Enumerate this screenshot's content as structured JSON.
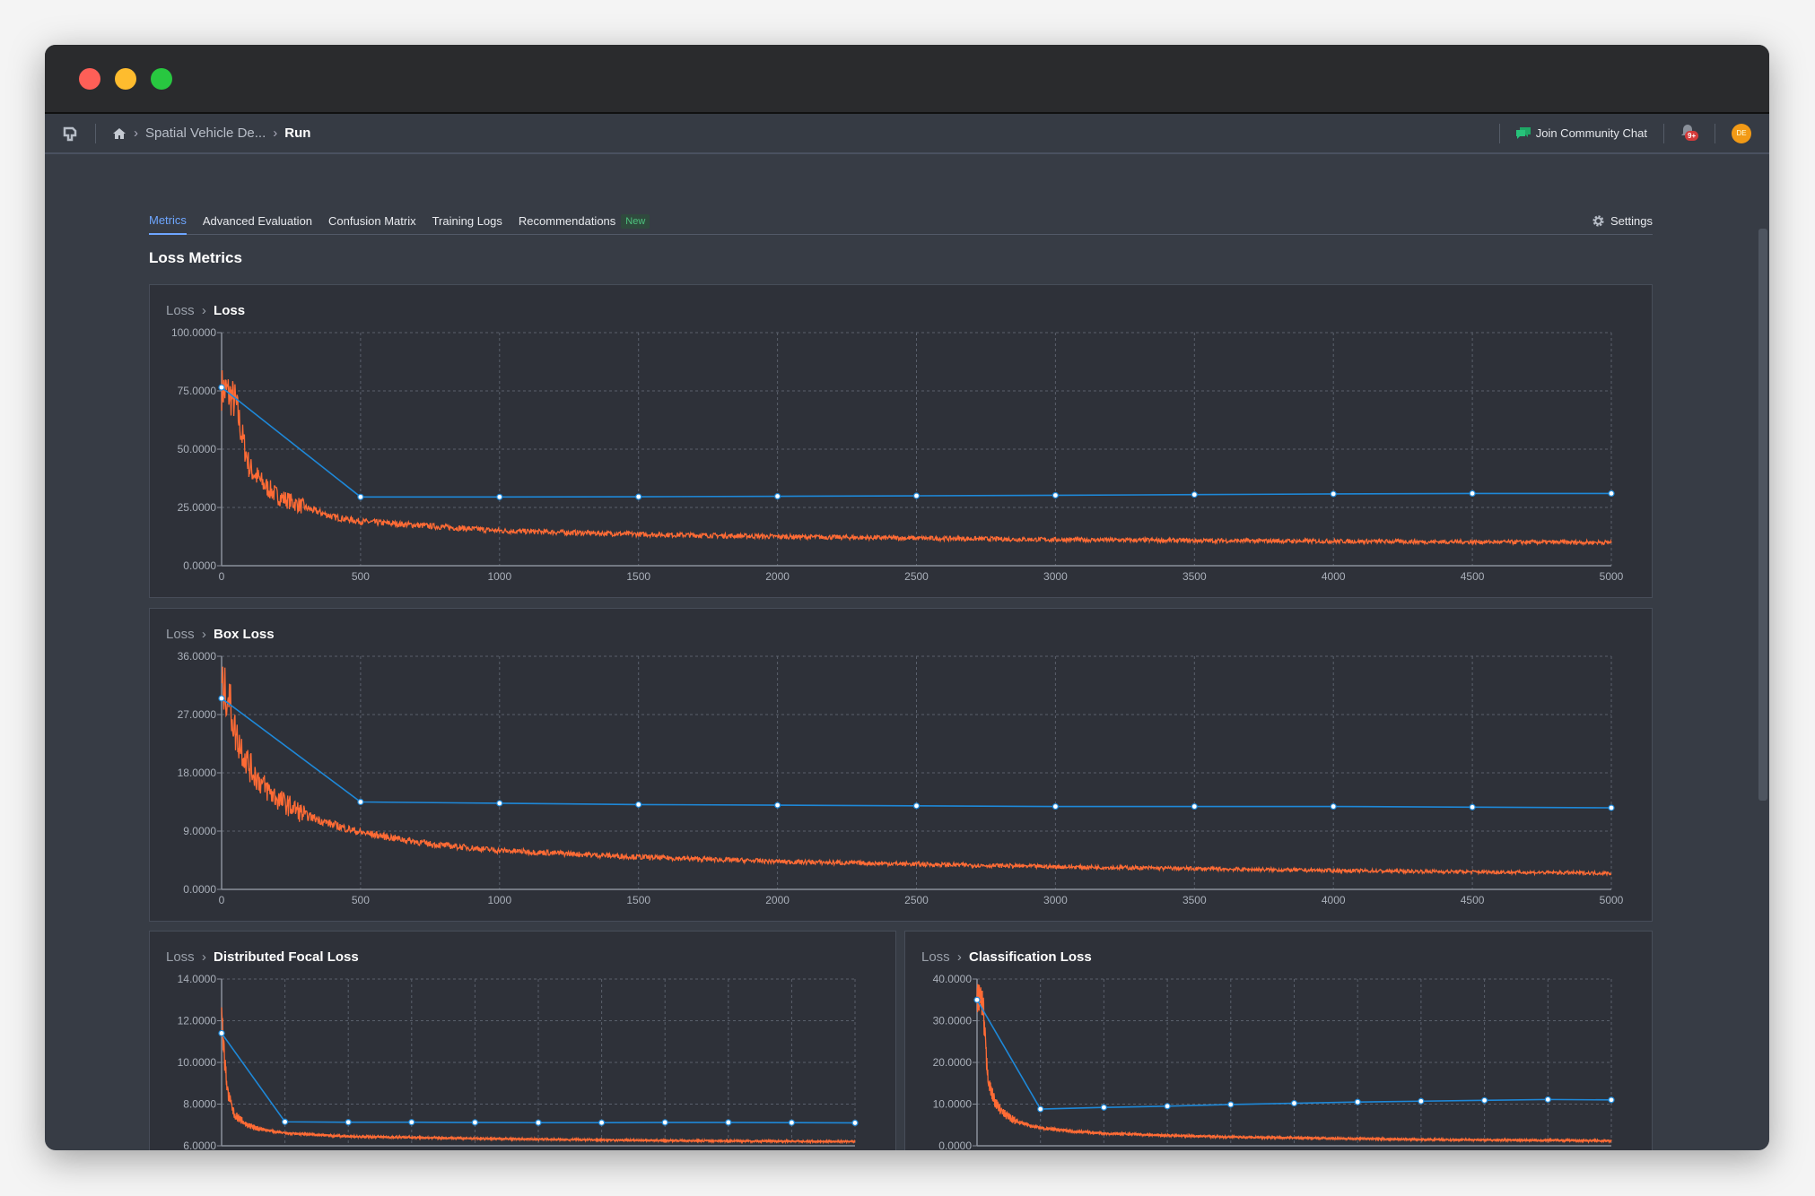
{
  "window": {
    "traffic_lights": [
      "#fe5f57",
      "#febc2e",
      "#28c840"
    ]
  },
  "navbar": {
    "breadcrumb": [
      "Spatial Vehicle De...",
      "Run"
    ],
    "community_chat": "Join Community Chat",
    "notifications_badge": "9+",
    "avatar_initials": "DE"
  },
  "tabs": [
    {
      "label": "Metrics",
      "active": true
    },
    {
      "label": "Advanced Evaluation"
    },
    {
      "label": "Confusion Matrix"
    },
    {
      "label": "Training Logs"
    },
    {
      "label": "Recommendations",
      "badge": "New"
    }
  ],
  "settings_label": "Settings",
  "section_title": "Loss Metrics",
  "colors": {
    "train": "#ff6b35",
    "validation": "#1e88d8"
  },
  "chart_data": [
    {
      "type": "line",
      "parent": "Loss",
      "title": "Loss",
      "xlim": [
        0,
        5000
      ],
      "xticks": [
        0,
        500,
        1000,
        1500,
        2000,
        2500,
        3000,
        3500,
        4000,
        4500,
        5000
      ],
      "ylim": [
        0,
        100
      ],
      "yticks": [
        0,
        25,
        50,
        75,
        100
      ],
      "grid": true,
      "series": [
        {
          "x": [
            0,
            25,
            50,
            75,
            100,
            150,
            200,
            300,
            400,
            500,
            750,
            1000,
            1500,
            2000,
            2500,
            3000,
            3500,
            4000,
            4500,
            5000
          ],
          "y": [
            76,
            74,
            70,
            55,
            42,
            35,
            30,
            25,
            21,
            19,
            17,
            15,
            13.5,
            12.5,
            11.8,
            11.2,
            10.8,
            10.5,
            10.2,
            10
          ]
        },
        {
          "x": [
            0,
            500,
            1000,
            1500,
            2000,
            2500,
            3000,
            3500,
            4000,
            4500,
            5000
          ],
          "y": [
            76.5,
            29.5,
            29.5,
            29.6,
            29.8,
            30,
            30.2,
            30.5,
            30.8,
            31,
            31
          ],
          "markers": true
        }
      ]
    },
    {
      "type": "line",
      "parent": "Loss",
      "title": "Box Loss",
      "xlim": [
        0,
        5000
      ],
      "xticks": [
        0,
        500,
        1000,
        1500,
        2000,
        2500,
        3000,
        3500,
        4000,
        4500,
        5000
      ],
      "ylim": [
        0,
        36
      ],
      "yticks": [
        0,
        9,
        18,
        27,
        36
      ],
      "grid": true,
      "series": [
        {
          "x": [
            0,
            25,
            50,
            100,
            150,
            200,
            300,
            400,
            500,
            750,
            1000,
            1500,
            2000,
            2500,
            3000,
            3500,
            4000,
            4500,
            5000
          ],
          "y": [
            31,
            30,
            24,
            19,
            16,
            14,
            11.5,
            10,
            8.8,
            7,
            6,
            5,
            4.3,
            3.9,
            3.5,
            3.2,
            2.9,
            2.7,
            2.5
          ]
        },
        {
          "x": [
            0,
            500,
            1000,
            1500,
            2000,
            2500,
            3000,
            3500,
            4000,
            4500,
            5000
          ],
          "y": [
            29.5,
            13.5,
            13.3,
            13.1,
            13.0,
            12.9,
            12.8,
            12.8,
            12.8,
            12.7,
            12.6
          ],
          "markers": true
        }
      ]
    },
    {
      "type": "line",
      "parent": "Loss",
      "title": "Distributed Focal Loss",
      "xlim": [
        0,
        5000
      ],
      "xticks": [
        0,
        500,
        1000,
        1500,
        2000,
        2500,
        3000,
        3500,
        4000,
        4500,
        5000
      ],
      "ylim": [
        6,
        14
      ],
      "yticks": [
        6,
        8,
        10,
        12,
        14
      ],
      "grid": true,
      "series": [
        {
          "x": [
            0,
            25,
            50,
            100,
            200,
            300,
            500,
            1000,
            2000,
            3000,
            4000,
            5000
          ],
          "y": [
            12.3,
            10,
            8.5,
            7.5,
            7.0,
            6.8,
            6.6,
            6.45,
            6.35,
            6.28,
            6.23,
            6.2
          ]
        },
        {
          "x": [
            0,
            500,
            1000,
            1500,
            2000,
            2500,
            3000,
            3500,
            4000,
            4500,
            5000
          ],
          "y": [
            11.4,
            7.15,
            7.13,
            7.13,
            7.12,
            7.11,
            7.11,
            7.12,
            7.12,
            7.11,
            7.1
          ],
          "markers": true
        }
      ]
    },
    {
      "type": "line",
      "parent": "Loss",
      "title": "Classification Loss",
      "xlim": [
        0,
        5000
      ],
      "xticks": [
        0,
        500,
        1000,
        1500,
        2000,
        2500,
        3000,
        3500,
        4000,
        4500,
        5000
      ],
      "ylim": [
        0,
        40
      ],
      "yticks": [
        0,
        10,
        20,
        30,
        40
      ],
      "grid": true,
      "series": [
        {
          "x": [
            0,
            25,
            50,
            75,
            100,
            150,
            200,
            300,
            400,
            500,
            750,
            1000,
            1500,
            2000,
            2500,
            3000,
            3500,
            4000,
            4500,
            5000
          ],
          "y": [
            36,
            35.5,
            32,
            20,
            14,
            10,
            8,
            6,
            5,
            4.3,
            3.5,
            3,
            2.5,
            2.1,
            1.9,
            1.7,
            1.5,
            1.4,
            1.3,
            1.2
          ]
        },
        {
          "x": [
            0,
            500,
            1000,
            1500,
            2000,
            2500,
            3000,
            3500,
            4000,
            4500,
            5000
          ],
          "y": [
            35,
            8.8,
            9.2,
            9.5,
            9.9,
            10.2,
            10.5,
            10.7,
            10.9,
            11.1,
            11.0
          ],
          "markers": true
        }
      ]
    }
  ]
}
